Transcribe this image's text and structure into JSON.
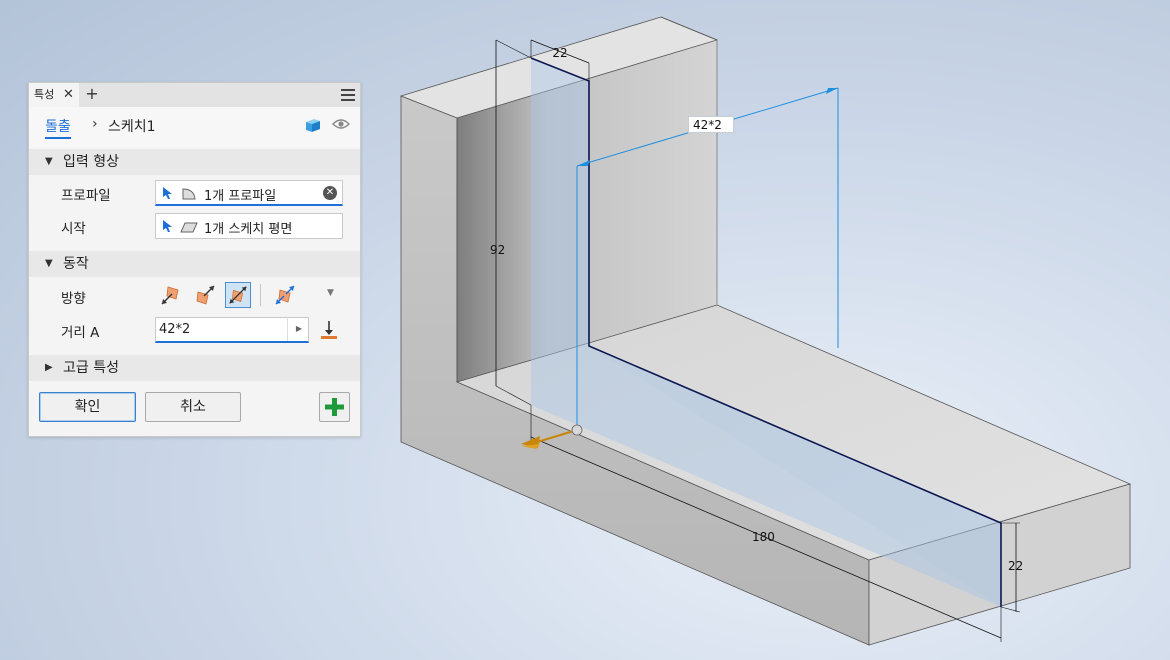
{
  "panel": {
    "tab_label": "특성",
    "tab_close": "✕",
    "tab_add": "+",
    "breadcrumb": {
      "feature": "돌출",
      "separator": "›",
      "sketch": "스케치1"
    },
    "input_section": {
      "title": "입력 형상",
      "profile_label": "프로파일",
      "profile_value": "1개 프로파일",
      "start_label": "시작",
      "start_value": "1개 스케치 평면"
    },
    "behavior_section": {
      "title": "동작",
      "direction_label": "방향",
      "distance_label": "거리 A",
      "distance_value": "42*2"
    },
    "advanced_section": {
      "title": "고급 특성"
    },
    "ok_label": "확인",
    "cancel_label": "취소"
  },
  "viewport": {
    "dimensions": {
      "width_top": "22",
      "height": "92",
      "length": "180",
      "thickness": "22"
    },
    "extent_expression": "42*2"
  },
  "colors": {
    "accent": "#1e6fd9",
    "edge": "#0a1650",
    "preview": "#a9c6e6",
    "manipulator": "#c8860a",
    "add_green": "#1f9a3a"
  }
}
